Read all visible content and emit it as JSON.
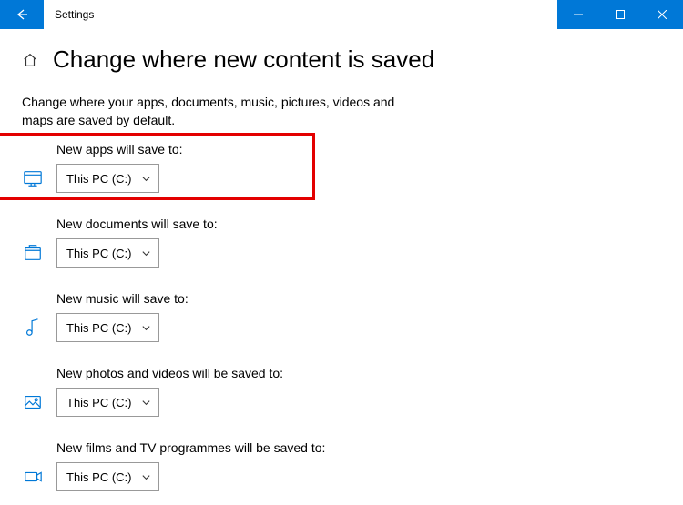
{
  "titlebar": {
    "app_title": "Settings"
  },
  "page": {
    "title": "Change where new content is saved",
    "description": "Change where your apps, documents, music, pictures, videos and maps are saved by default."
  },
  "settings": {
    "apps": {
      "label": "New apps will save to:",
      "value": "This PC (C:)"
    },
    "documents": {
      "label": "New documents will save to:",
      "value": "This PC (C:)"
    },
    "music": {
      "label": "New music will save to:",
      "value": "This PC (C:)"
    },
    "photos": {
      "label": "New photos and videos will be saved to:",
      "value": "This PC (C:)"
    },
    "films": {
      "label": "New films and TV programmes will be saved to:",
      "value": "This PC (C:)"
    }
  }
}
